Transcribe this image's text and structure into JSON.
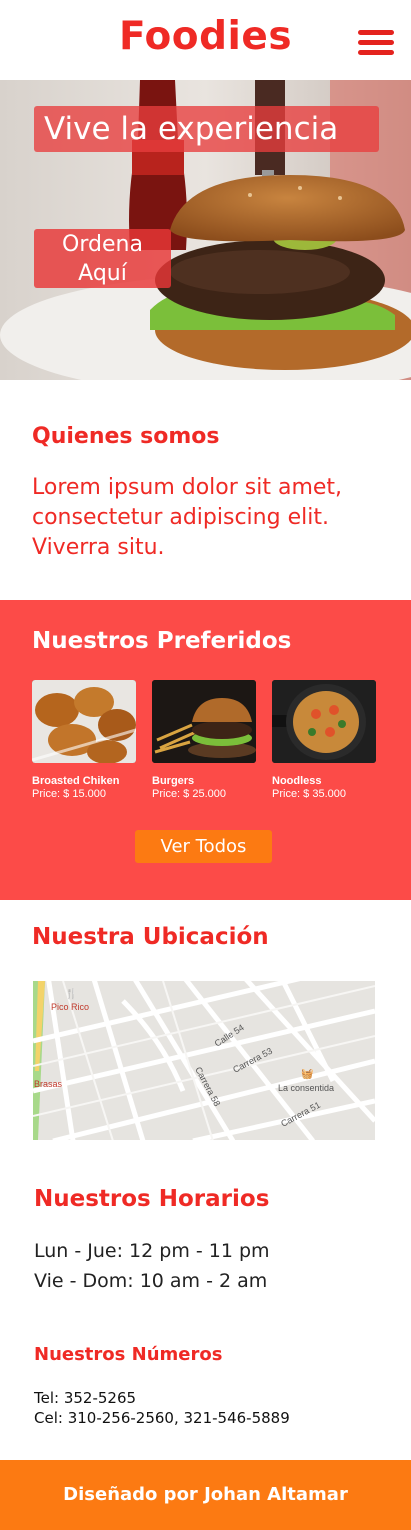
{
  "header": {
    "logo": "Foodies",
    "menu_icon": "hamburger-menu-icon"
  },
  "hero": {
    "title": "Vive la experiencia",
    "cta_line1": "Ordena",
    "cta_line2": "Aquí"
  },
  "about": {
    "title": "Quienes somos",
    "text": "Lorem ipsum dolor sit amet, consectetur adipiscing elit. Viverra situ."
  },
  "favorites": {
    "title": "Nuestros Preferidos",
    "items": [
      {
        "name": "Broasted Chiken",
        "price": "Price: $ 15.000"
      },
      {
        "name": "Burgers",
        "price": "Price: $ 25.000"
      },
      {
        "name": "Noodless",
        "price": "Price: $ 35.000"
      }
    ],
    "button": "Ver Todos"
  },
  "location": {
    "title": "Nuestra Ubicación",
    "map_labels": {
      "pico_rico": "Pico Rico",
      "brasas": "Brasas",
      "calle54": "Calle 54",
      "carrera53": "Carrera 53",
      "carrera58": "Carrera 58",
      "la_consentida": "La consentida",
      "carrera51": "Carrera 51"
    }
  },
  "hours": {
    "title": "Nuestros Horarios",
    "weekday": "Lun - Jue: 12 pm - 11 pm",
    "weekend": "Vie - Dom: 10 am - 2 am"
  },
  "numbers": {
    "title": "Nuestros Números",
    "tel": "Tel: 352-5265",
    "cel": "Cel: 310-256-2560, 321-546-5889"
  },
  "footer": {
    "credit": "Diseñado por Johan Altamar"
  },
  "colors": {
    "brand_red": "#ef2a25",
    "section_red": "#fc4b48",
    "orange": "#fc7a12"
  }
}
